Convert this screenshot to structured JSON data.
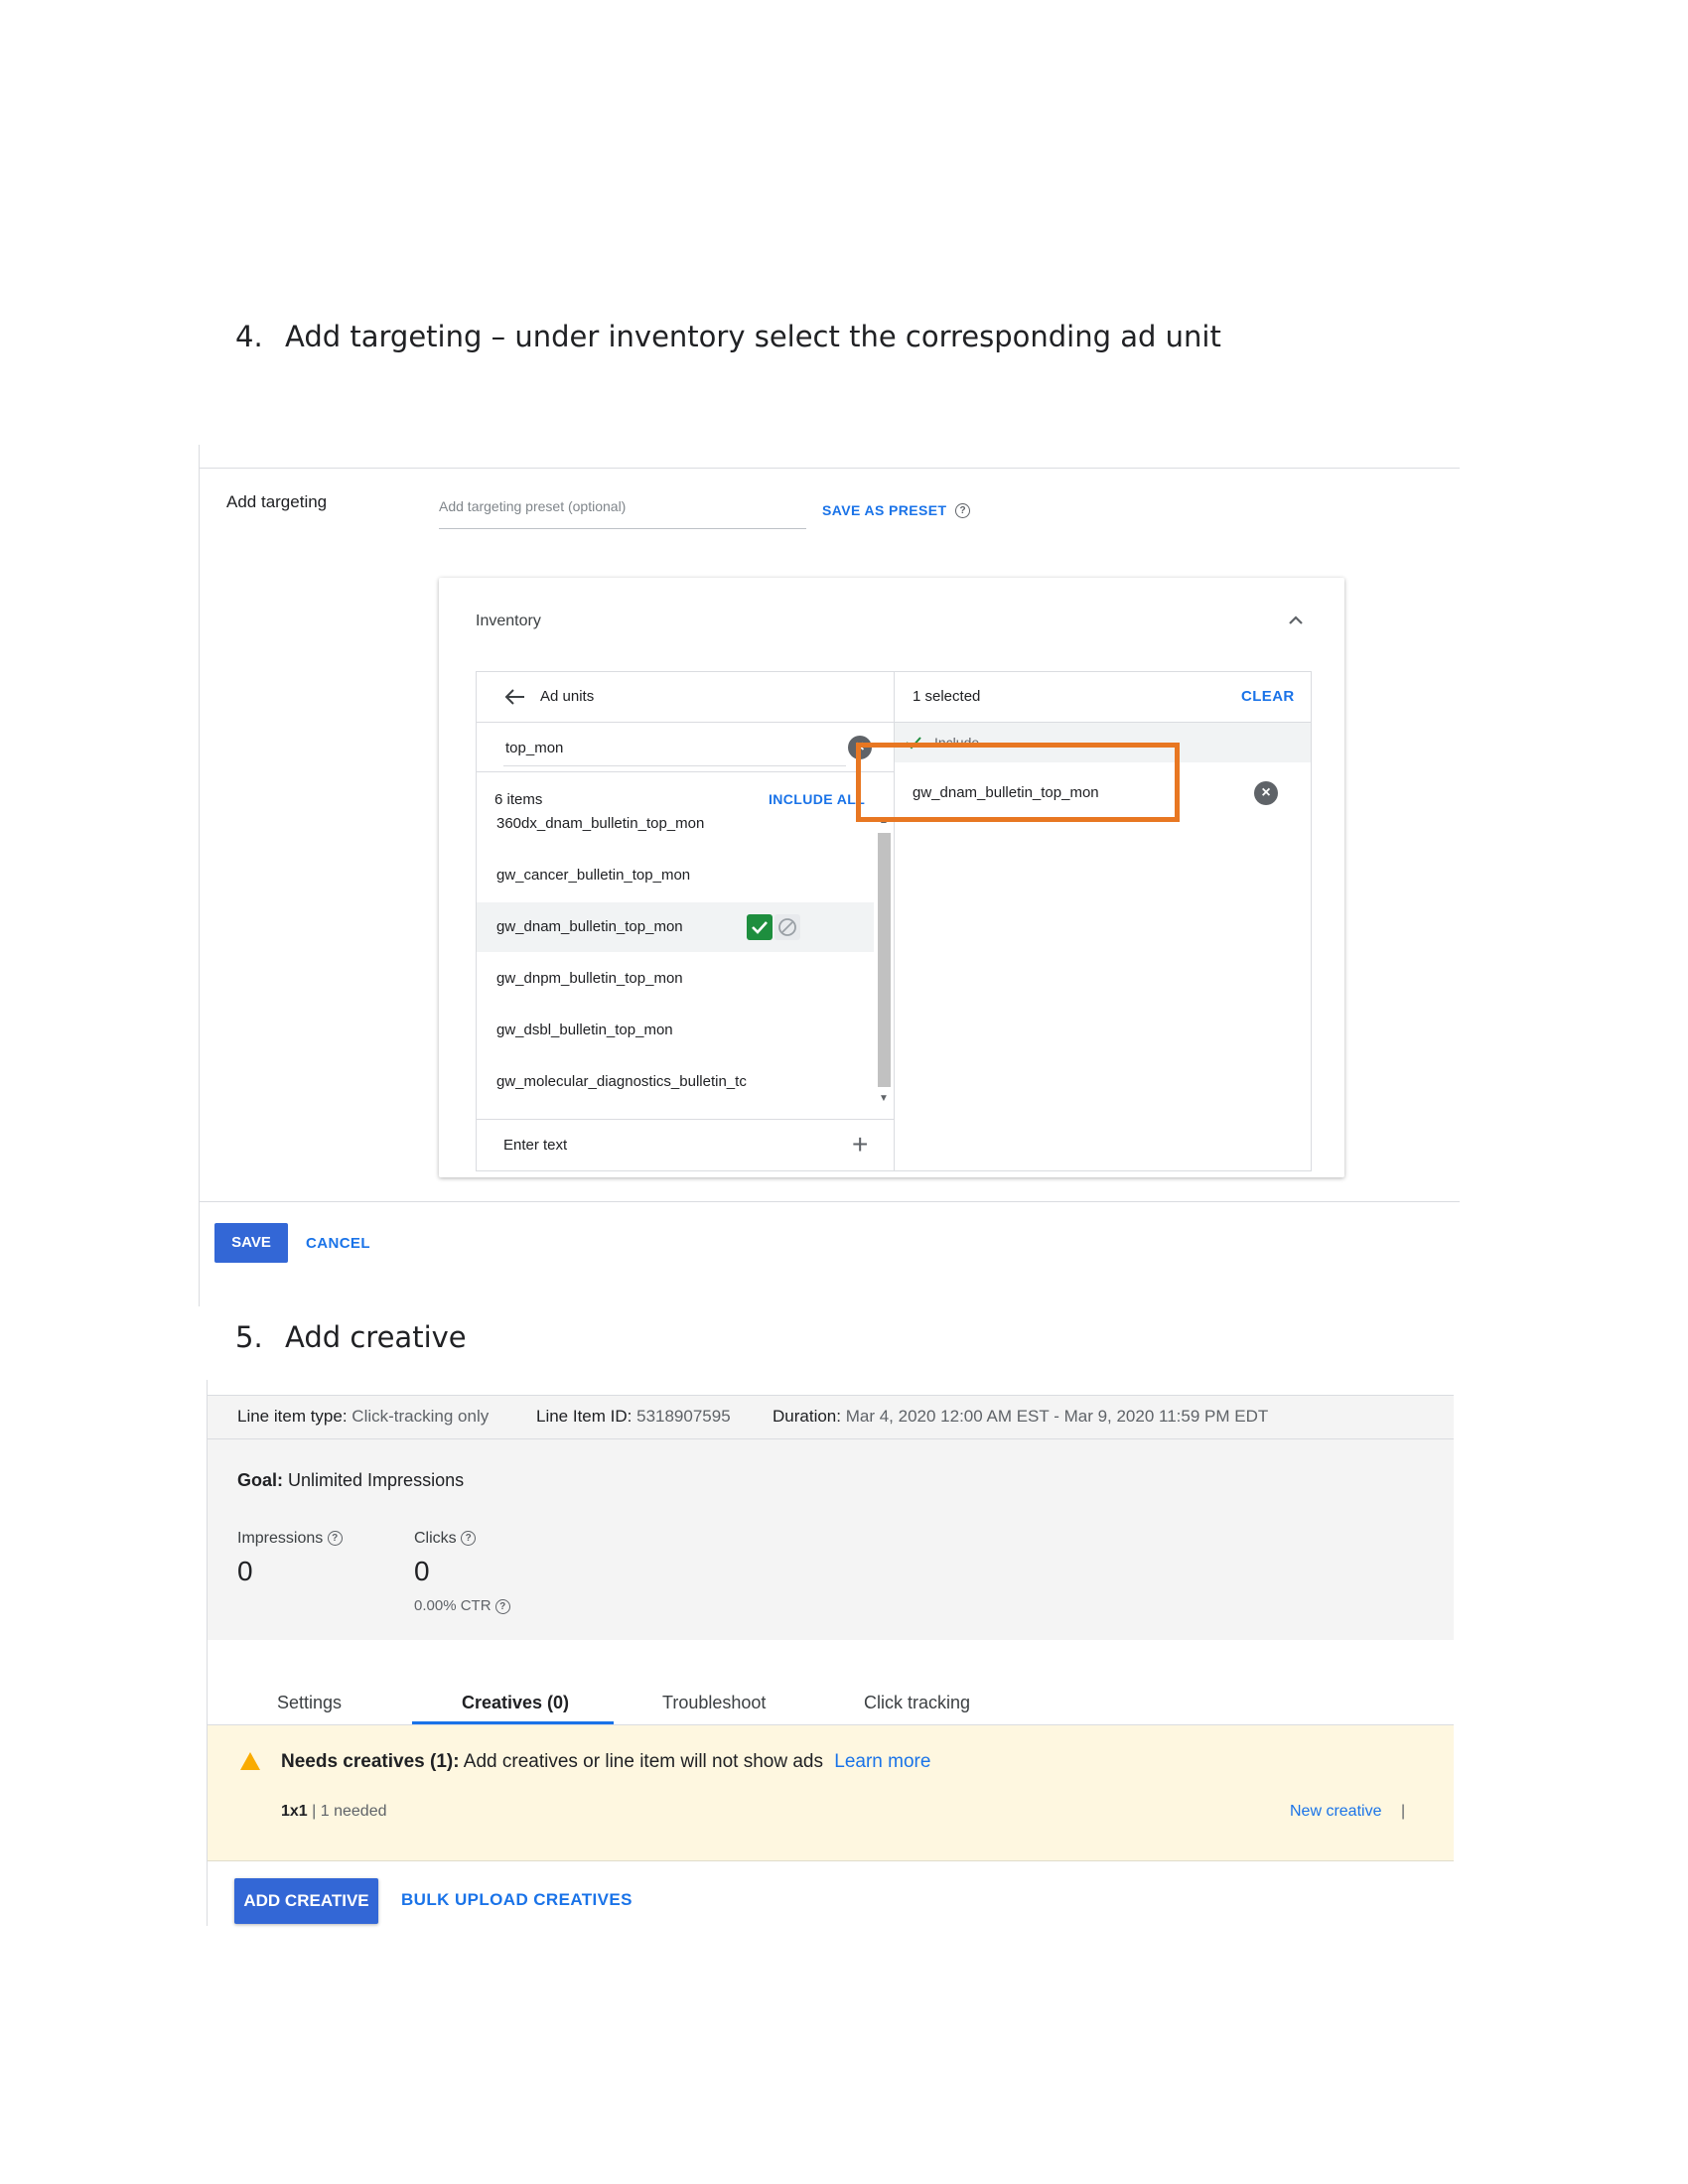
{
  "step4": {
    "number": "4.",
    "text": "Add targeting – under inventory select the corresponding ad unit"
  },
  "targeting": {
    "label": "Add targeting",
    "preset_placeholder": "Add targeting preset (optional)",
    "save_as_preset": "SAVE AS PRESET",
    "help_glyph": "?"
  },
  "inventory": {
    "title": "Inventory",
    "left_header": "Ad units",
    "search_value": "top_mon",
    "items_count": "6 items",
    "include_all": "INCLUDE ALL",
    "items": [
      "360dx_dnam_bulletin_top_mon",
      "gw_cancer_bulletin_top_mon",
      "gw_dnam_bulletin_top_mon",
      "gw_dnpm_bulletin_top_mon",
      "gw_dsbl_bulletin_top_mon",
      "gw_molecular_diagnostics_bulletin_tc"
    ],
    "selected_item_index": 2,
    "enter_text": "Enter text",
    "selected_count": "1 selected",
    "clear": "CLEAR",
    "include_label": "Include",
    "selected_items": [
      "gw_dnam_bulletin_top_mon"
    ],
    "highlight_color": "#e87722"
  },
  "form_buttons": {
    "save": "SAVE",
    "cancel": "CANCEL"
  },
  "step5": {
    "number": "5.",
    "text": "Add creative"
  },
  "line_item": {
    "type_label": "Line item type:",
    "type_value": "Click-tracking only",
    "id_label": "Line Item ID:",
    "id_value": "5318907595",
    "duration_label": "Duration:",
    "duration_value": "Mar 4, 2020 12:00 AM EST - Mar 9, 2020 11:59 PM EDT",
    "goal_label": "Goal:",
    "goal_value": "Unlimited Impressions",
    "impressions_label": "Impressions",
    "impressions_value": "0",
    "clicks_label": "Clicks",
    "clicks_value": "0",
    "ctr": "0.00% CTR"
  },
  "tabs": [
    "Settings",
    "Creatives (0)",
    "Troubleshoot",
    "Click tracking"
  ],
  "active_tab_index": 1,
  "warning": {
    "title": "Needs creatives (1):",
    "message": "Add creatives or line item will not show ads",
    "learn_more": "Learn more",
    "size": "1x1",
    "needed": "1 needed",
    "new_creative": "New creative",
    "separator": "|"
  },
  "creative_buttons": {
    "add": "ADD CREATIVE",
    "bulk": "BULK UPLOAD CREATIVES"
  },
  "colors": {
    "primary": "#1a73e8",
    "button_bg": "#3367d6",
    "check_green": "#1e8e3e",
    "warning_bg": "#fef7e0",
    "warning_icon": "#f9ab00"
  }
}
